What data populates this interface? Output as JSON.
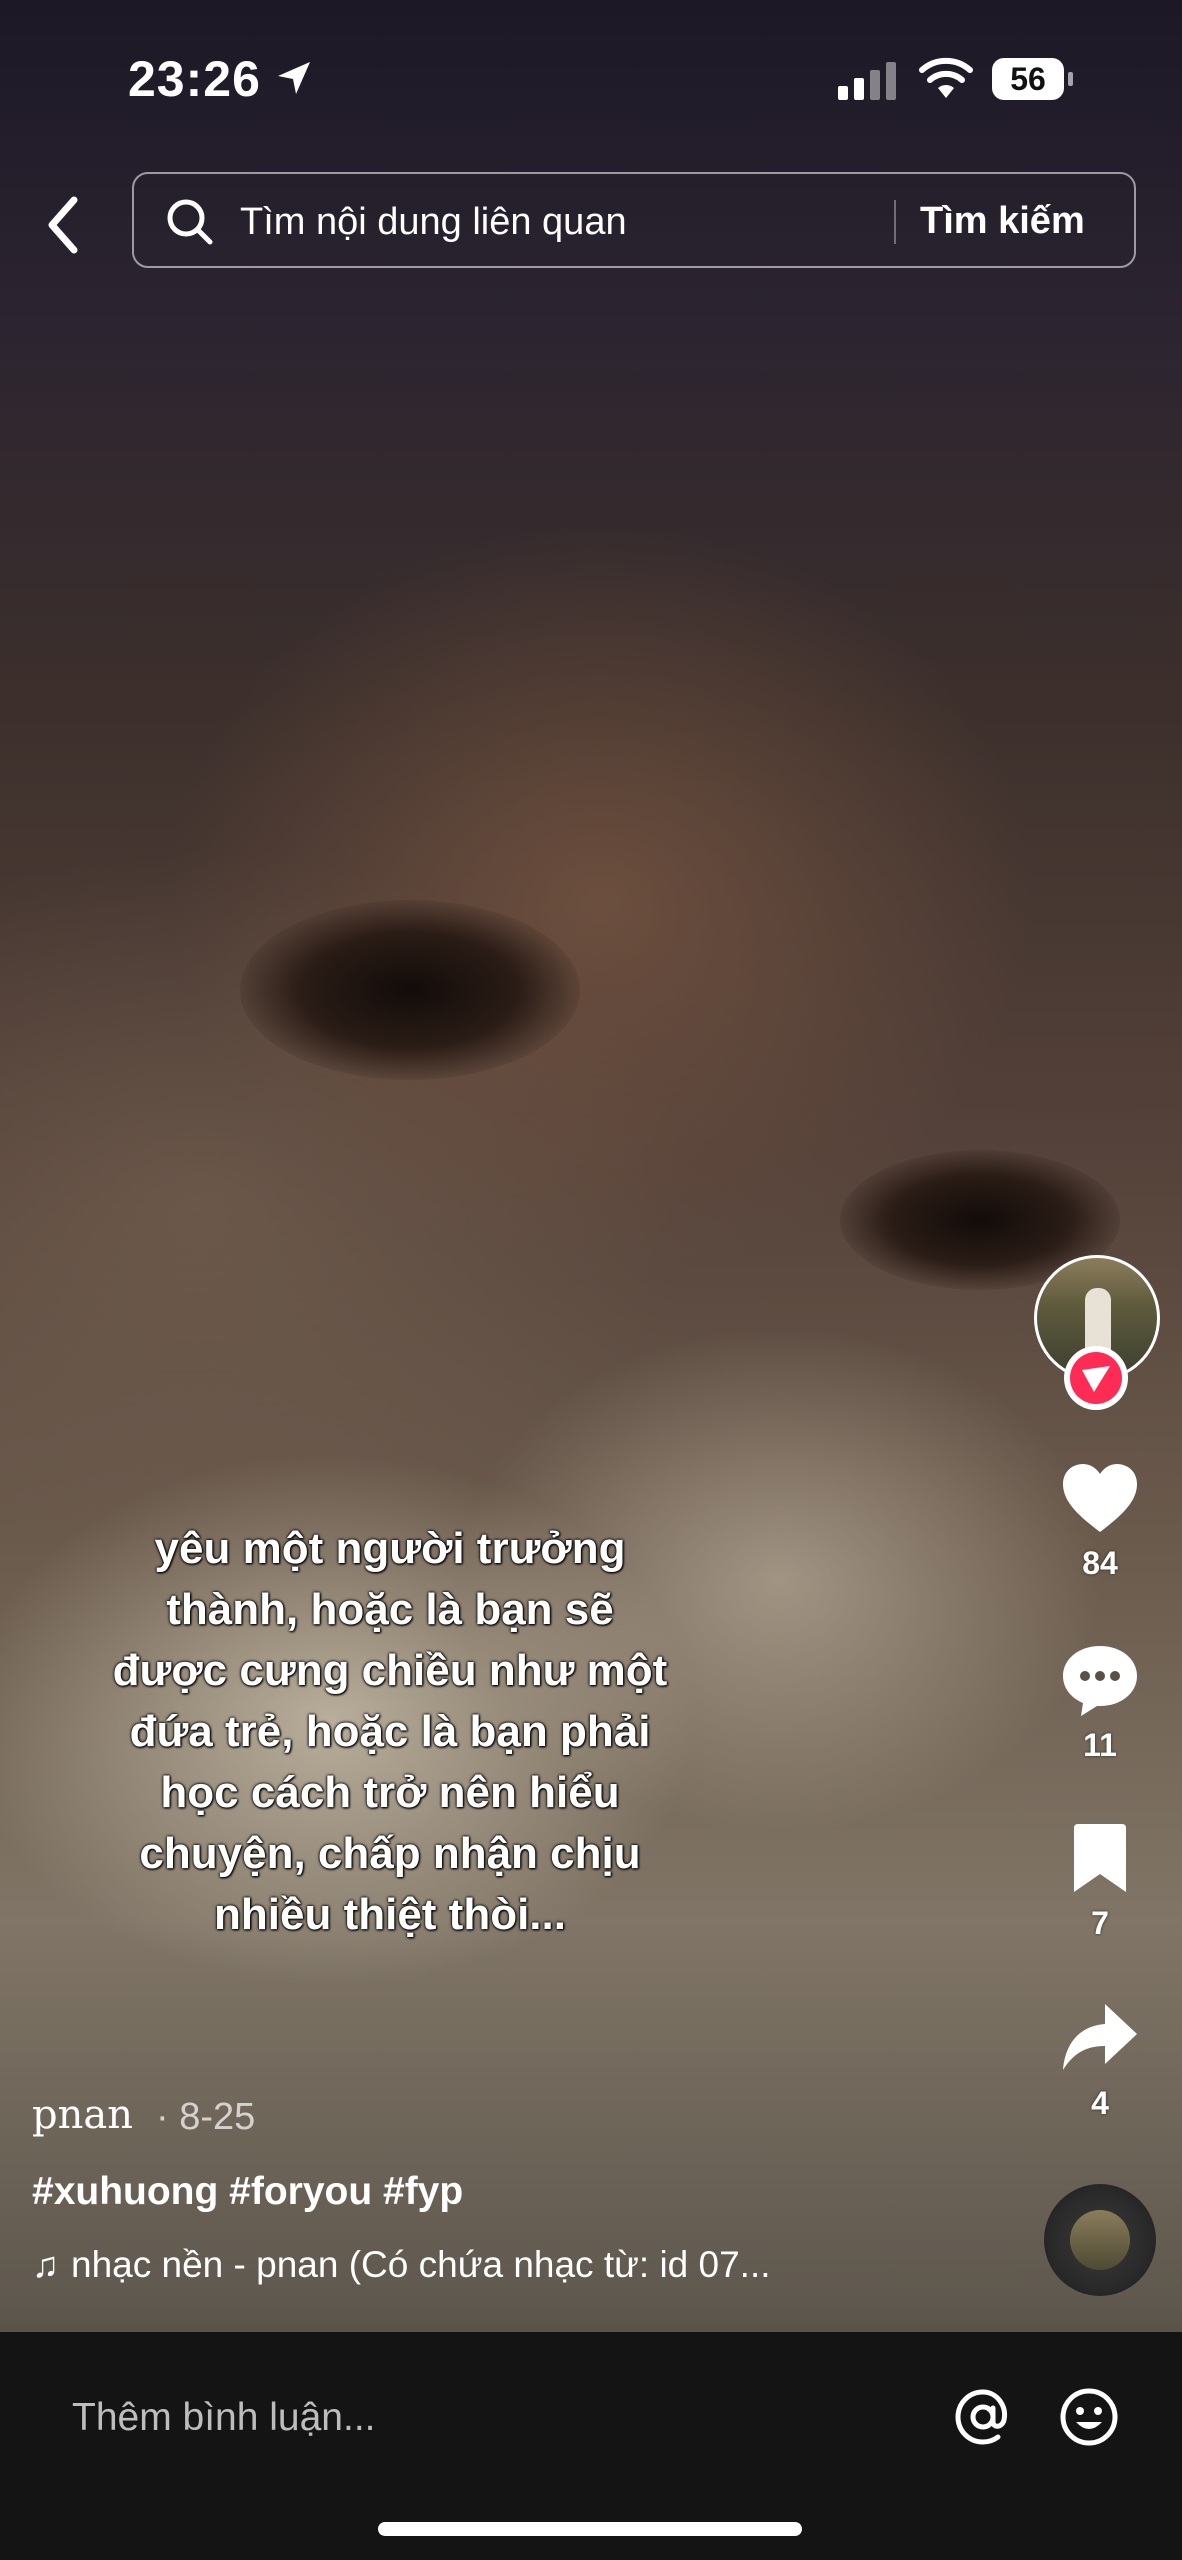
{
  "status_bar": {
    "time": "23:26",
    "battery": "56"
  },
  "search": {
    "placeholder": "Tìm nội dung liên quan",
    "button_label": "Tìm kiếm"
  },
  "video": {
    "caption_lines": [
      "yêu một người trưởng",
      "thành, hoặc là bạn sẽ",
      "được cưng chiều như một",
      "đứa trẻ, hoặc là bạn phải",
      "học cách trở nên hiểu",
      "chuyện, chấp nhận chịu",
      "nhiều thiệt thòi..."
    ]
  },
  "actions": {
    "likes": "84",
    "comments": "11",
    "saves": "7",
    "shares": "4"
  },
  "post": {
    "username": "pnan",
    "date": "· 8-25",
    "hashtags": "#xuhuong #foryou #fyp",
    "music": "nhạc nền - pnan (Có chứa nhạc từ: id 07..."
  },
  "comment": {
    "placeholder": "Thêm bình luận..."
  },
  "colors": {
    "accent": "#fe2c55",
    "background_bar": "#141414",
    "text": "#ffffff"
  }
}
